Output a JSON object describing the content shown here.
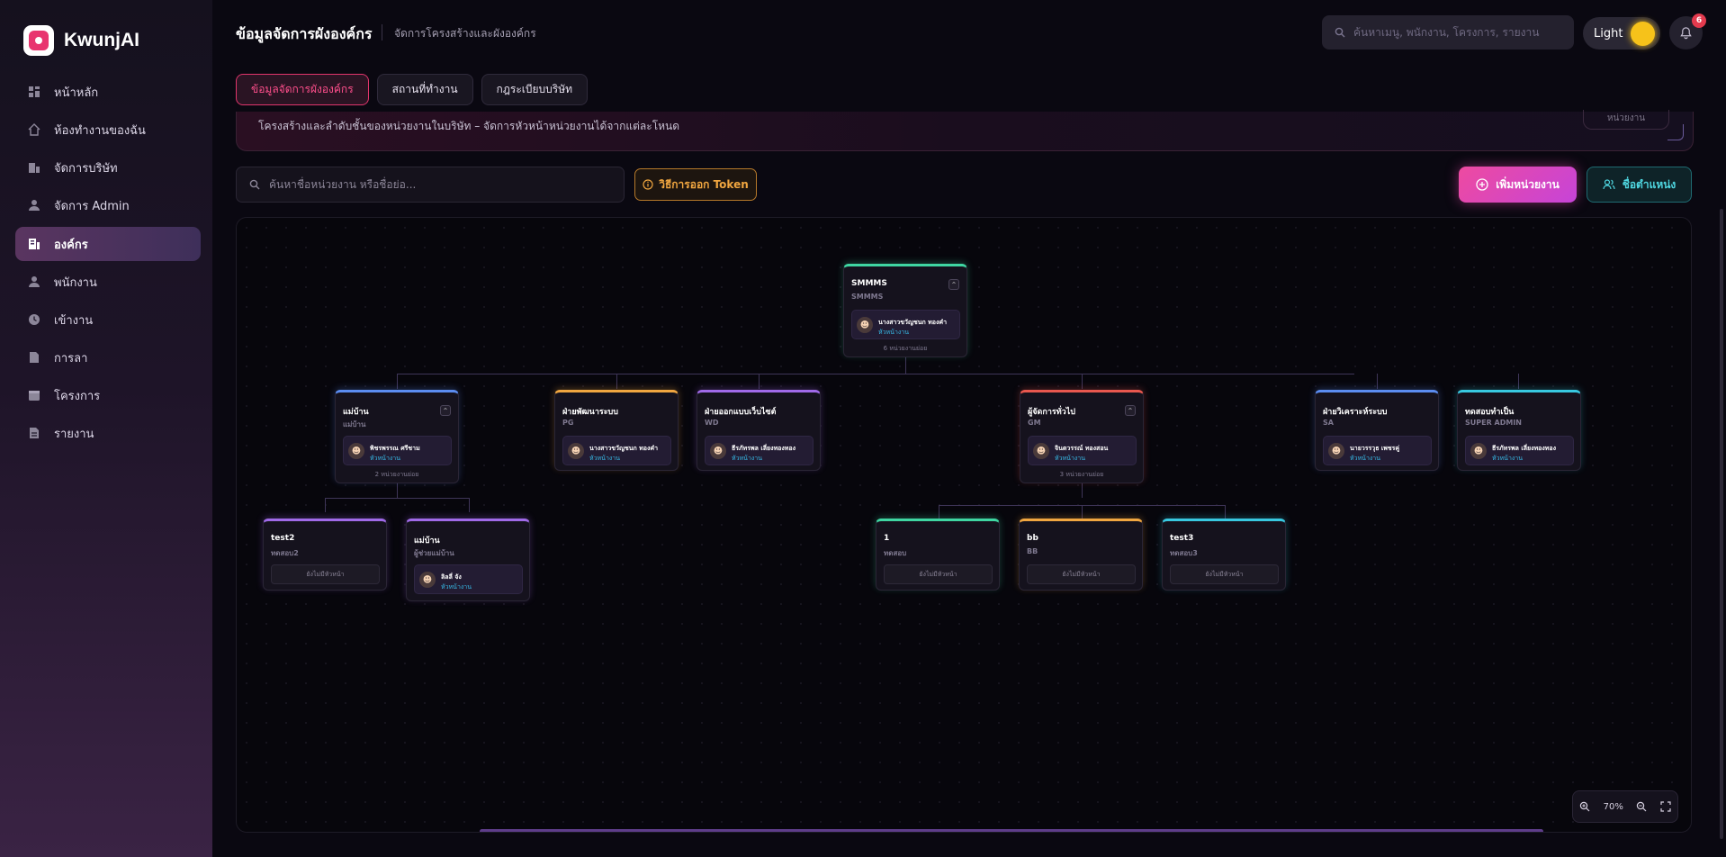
{
  "app": {
    "name": "KwunjAI"
  },
  "sidebar": {
    "items": [
      {
        "label": "หน้าหลัก",
        "icon": "dashboard-icon"
      },
      {
        "label": "ห้องทำงานของฉัน",
        "icon": "home-icon"
      },
      {
        "label": "จัดการบริษัท",
        "icon": "company-icon"
      },
      {
        "label": "จัดการ Admin",
        "icon": "admin-icon"
      },
      {
        "label": "องค์กร",
        "icon": "organization-icon",
        "active": true
      },
      {
        "label": "พนักงาน",
        "icon": "employee-icon"
      },
      {
        "label": "เข้างาน",
        "icon": "clock-icon"
      },
      {
        "label": "การลา",
        "icon": "document-icon"
      },
      {
        "label": "โครงการ",
        "icon": "project-icon"
      },
      {
        "label": "รายงาน",
        "icon": "report-icon"
      }
    ]
  },
  "header": {
    "title": "ข้อมูลจัดการผังองค์กร",
    "subtitle": "จัดการโครงสร้างและผังองค์กร",
    "search_placeholder": "ค้นหาเมนู, พนักงาน, โครงการ, รายงาน",
    "theme_label": "Light",
    "notification_count": "6"
  },
  "tabs": [
    {
      "label": "ข้อมูลจัดการผังองค์กร",
      "active": true
    },
    {
      "label": "สถานที่ทำงาน"
    },
    {
      "label": "กฎระเบียบบริษัท"
    }
  ],
  "banner": {
    "text": "โครงสร้างและลำดับชั้นของหน่วยงานในบริษัท – จัดการหัวหน้าหน่วยงานได้จากแต่ละโหนด",
    "button": "หน่วยงาน"
  },
  "toolbar": {
    "search_placeholder": "ค้นหาชื่อหน่วยงาน หรือชื่อย่อ...",
    "token_label": "วิธีการออก Token",
    "add_label": "เพิ่มหน่วยงาน",
    "position_label": "ชื่อตำแหน่ง"
  },
  "org": {
    "root": {
      "name": "SMMMS",
      "code": "SMMMS",
      "head": "นางสาวขวัญชนก ทองคำ",
      "role": "หัวหน้างาน",
      "sub": "6 หน่วยงานย่อย",
      "color": "#3fd6a2"
    },
    "level1": [
      {
        "name": "แม่บ้าน",
        "code": "แม่บ้าน",
        "head": "พิชรพรรณ ศรีชาม",
        "role": "หัวหน้างาน",
        "sub": "2 หน่วยงานย่อย",
        "color": "#5b8cf0",
        "collapse": true
      },
      {
        "name": "ฝ่ายพัฒนาระบบ",
        "code": "PG",
        "head": "นางสาวขวัญชนก ทองคำ",
        "role": "หัวหน้างาน",
        "color": "#f0a640"
      },
      {
        "name": "ฝ่ายออกแบบเว็บไซต์",
        "code": "WD",
        "head": "ธีรภัทรพล เลี่ยงทองทอง",
        "role": "หัวหน้างาน",
        "color": "#a06ae8"
      },
      {
        "name": "ผู้จัดการทั่วไป",
        "code": "GM",
        "head": "จินตวรรณ์ ทองสอน",
        "role": "หัวหน้างาน",
        "sub": "3 หน่วยงานย่อย",
        "color": "#e8574e",
        "collapse": true
      },
      {
        "name": "ฝ่ายวิเคราะห์ระบบ",
        "code": "SA",
        "head": "นายวรรวุธ เพชรคู่",
        "role": "หัวหน้างาน",
        "color": "#5b8cf0"
      },
      {
        "name": "ทดสอบทำเป็น",
        "code": "SUPER ADMIN",
        "head": "ธีรภัทรพล เลี่ยงทองทอง",
        "role": "หัวหน้างาน",
        "color": "#38c8e0"
      }
    ],
    "level2_left": [
      {
        "name": "test2",
        "code": "ทดสอบ2",
        "nohead": "ยังไม่มีหัวหน้า",
        "color": "#a06ae8"
      },
      {
        "name": "แม่บ้าน",
        "code": "ผู้ช่วยแม่บ้าน",
        "head": "ลิลลี่ จัง",
        "role": "หัวหน้างาน",
        "color": "#a06ae8"
      }
    ],
    "level2_right": [
      {
        "name": "1",
        "code": "ทดสอบ",
        "nohead": "ยังไม่มีหัวหน้า",
        "color": "#3fd6a2"
      },
      {
        "name": "bb",
        "code": "BB",
        "nohead": "ยังไม่มีหัวหน้า",
        "color": "#f0a640"
      },
      {
        "name": "test3",
        "code": "ทดสอบ3",
        "nohead": "ยังไม่มีหัวหน้า",
        "color": "#38c8e0"
      }
    ]
  },
  "zoom": {
    "level": "70%"
  }
}
